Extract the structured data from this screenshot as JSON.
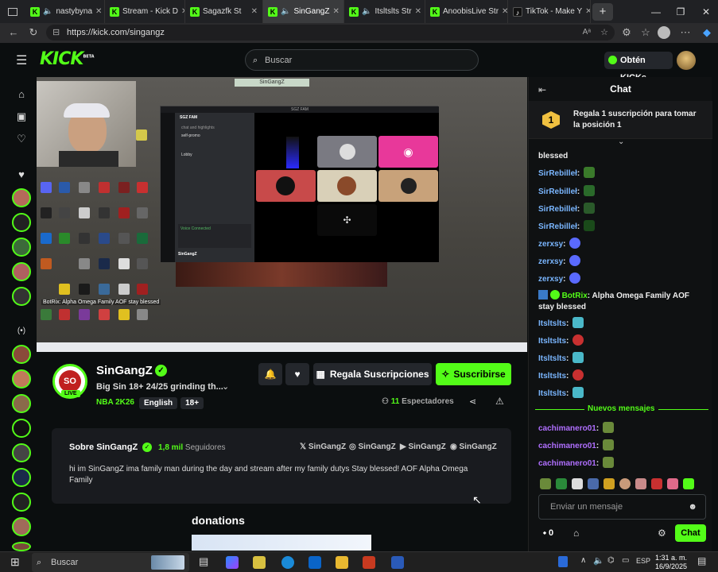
{
  "browser": {
    "tabs": [
      {
        "label": "nastybyna",
        "icon": "kick-icon",
        "active": false
      },
      {
        "label": "Stream - Kick D",
        "icon": "kick-icon",
        "active": false
      },
      {
        "label": "Sagazfk St",
        "icon": "kick-icon",
        "active": false
      },
      {
        "label": "SinGangZ",
        "icon": "kick-icon",
        "active": true
      },
      {
        "label": "Itsltslts Str",
        "icon": "kick-icon",
        "active": false
      },
      {
        "label": "AnoobisLive Str",
        "icon": "kick-icon",
        "active": false
      },
      {
        "label": "TikTok - Make Y",
        "icon": "tiktok-icon",
        "active": false
      }
    ],
    "url": "https://kick.com/singangz"
  },
  "header": {
    "logo": "KICK",
    "logo_beta": "BETA",
    "search_placeholder": "Buscar",
    "get_kicks": "Obtén KICKs"
  },
  "stream_overlay": {
    "title_bar": "SinGangZ",
    "discord_server": "SGZ FAM",
    "discord_channels": [
      "chat and highlights",
      "self-promo",
      "Lobby"
    ],
    "discord_user": "SinGangZ",
    "voice_connected": "Voice Connected",
    "desktop_chat_line": "BotRix: Alpha Omega Family AOF stay blessed"
  },
  "channel": {
    "name": "SinGangZ",
    "badge": "SO",
    "live_label": "LIVE",
    "title": "Big Sin 18+ 24/25 grinding th...",
    "category": "NBA 2K26",
    "tags": [
      "English",
      "18+"
    ],
    "viewers_count": "11",
    "viewers_label": "Espectadores",
    "gift_label": "Regala Suscripciones",
    "subscribe_label": "Suscribirse"
  },
  "about": {
    "heading": "Sobre SinGangZ",
    "followers_count": "1,8 mil",
    "followers_label": "Seguidores",
    "socials": [
      "SinGangZ",
      "SinGangZ",
      "SinGangZ",
      "SinGangZ"
    ],
    "bio": "hi im SinGangZ ima family man during the day and stream after my family dutys Stay blessed! AOF Alpha Omega Family"
  },
  "donations_heading": "donations",
  "chat": {
    "title": "Chat",
    "promo": "Regala 1 suscripción para tomar la posición 1",
    "promo_rank": "1",
    "messages": [
      {
        "user": "",
        "text": "blessed"
      },
      {
        "user": "SirRebilleł",
        "text": ""
      },
      {
        "user": "SirRebilleł",
        "text": ""
      },
      {
        "user": "SirRebilleł",
        "text": ""
      },
      {
        "user": "SirRebilleł",
        "text": ""
      },
      {
        "user": "zerxsy",
        "text": ""
      },
      {
        "user": "zerxsy",
        "text": ""
      },
      {
        "user": "zerxsy",
        "text": ""
      },
      {
        "user": "BotRix",
        "text": "Alpha Omega Family AOF stay blessed"
      },
      {
        "user": "Itsltslts",
        "text": ""
      },
      {
        "user": "Itsltslts",
        "text": ""
      },
      {
        "user": "Itsltslts",
        "text": ""
      },
      {
        "user": "Itsltslts",
        "text": ""
      },
      {
        "user": "Itsltslts",
        "text": ""
      }
    ],
    "new_messages_label": "Nuevos mensajes",
    "new_messages": [
      {
        "user": "cachimanero01"
      },
      {
        "user": "cachimanero01"
      },
      {
        "user": "cachimanero01"
      }
    ],
    "input_placeholder": "Enviar un mensaje",
    "points": "0",
    "send_label": "Chat"
  },
  "taskbar": {
    "search": "Buscar",
    "lang": "ESP",
    "time": "1:31 a. m.",
    "date": "16/9/2025"
  },
  "colors": {
    "accent": "#53fc18",
    "bg": "#0b0e0f",
    "chat_user": "#7ab6ff",
    "new_user": "#b06fff"
  }
}
